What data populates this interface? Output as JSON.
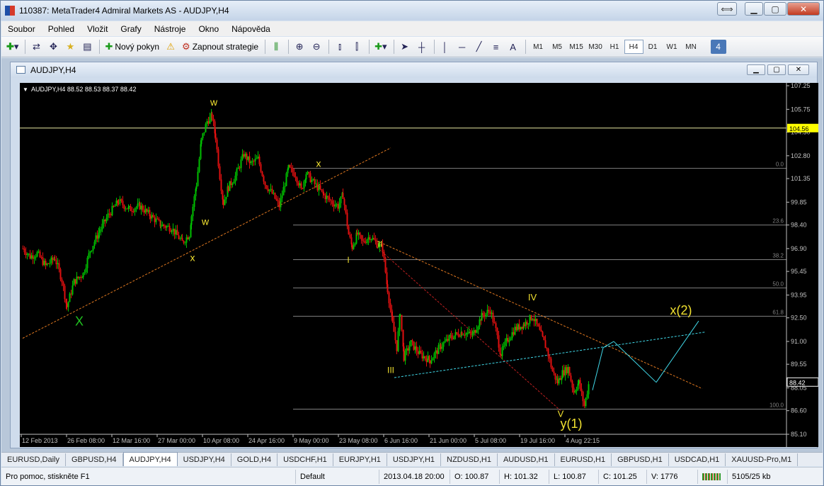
{
  "window": {
    "title": "110387: MetaTrader4 Admiral Markets AS - AUDJPY,H4"
  },
  "menu": [
    "Soubor",
    "Pohled",
    "Vložit",
    "Grafy",
    "Nástroje",
    "Okno",
    "Nápověda"
  ],
  "toolbar": {
    "new_order": "Nový pokyn",
    "autotrading": "Zapnout strategie",
    "text_tool": "A",
    "timeframes": [
      "M1",
      "M5",
      "M15",
      "M30",
      "H1",
      "H4",
      "D1",
      "W1",
      "MN"
    ],
    "selected_timeframe": "H4",
    "badge": "4"
  },
  "chart_window": {
    "title": "AUDJPY,H4"
  },
  "chart_data": {
    "type": "candlestick",
    "symbol_info": "AUDJPY,H4  88.52 88.53 88.37 88.42",
    "ylim": [
      85.1,
      107.25
    ],
    "y_ticks": [
      "107.25",
      "105.75",
      "104.30",
      "102.80",
      "101.35",
      "99.85",
      "98.40",
      "96.90",
      "95.45",
      "93.95",
      "92.50",
      "91.00",
      "89.55",
      "88.05",
      "86.60",
      "85.10"
    ],
    "x_ticks": [
      "12 Feb 2013",
      "26 Feb 08:00",
      "12 Mar 16:00",
      "27 Mar 00:00",
      "10 Apr 08:00",
      "24 Apr 16:00",
      "9 May 00:00",
      "23 May 08:00",
      "6 Jun 16:00",
      "21 Jun 00:00",
      "5 Jul 08:00",
      "19 Jul 16:00",
      "4 Aug 22:15"
    ],
    "price_path": [
      [
        0,
        96.9
      ],
      [
        10,
        96.4
      ],
      [
        20,
        96.6
      ],
      [
        32,
        95.8
      ],
      [
        45,
        96.3
      ],
      [
        55,
        94.9
      ],
      [
        62,
        93.2
      ],
      [
        72,
        94.8
      ],
      [
        85,
        95.3
      ],
      [
        95,
        96.8
      ],
      [
        108,
        98.0
      ],
      [
        120,
        99.0
      ],
      [
        135,
        99.9
      ],
      [
        150,
        99.4
      ],
      [
        165,
        99.6
      ],
      [
        180,
        99.0
      ],
      [
        195,
        98.4
      ],
      [
        210,
        98.2
      ],
      [
        225,
        97.3
      ],
      [
        235,
        97.8
      ],
      [
        238,
        99.0
      ],
      [
        245,
        101.0
      ],
      [
        252,
        103.8
      ],
      [
        260,
        105.0
      ],
      [
        267,
        105.3
      ],
      [
        272,
        104.0
      ],
      [
        278,
        101.5
      ],
      [
        283,
        99.8
      ],
      [
        290,
        100.8
      ],
      [
        300,
        101.5
      ],
      [
        312,
        102.9
      ],
      [
        322,
        102.3
      ],
      [
        332,
        102.6
      ],
      [
        342,
        101.0
      ],
      [
        352,
        100.4
      ],
      [
        362,
        99.6
      ],
      [
        375,
        102.0
      ],
      [
        385,
        101.6
      ],
      [
        393,
        100.6
      ],
      [
        400,
        101.7
      ],
      [
        410,
        101.1
      ],
      [
        418,
        100.7
      ],
      [
        425,
        100.3
      ],
      [
        435,
        99.9
      ],
      [
        445,
        99.6
      ],
      [
        452,
        100.3
      ],
      [
        460,
        97.8
      ],
      [
        465,
        97.0
      ],
      [
        472,
        97.8
      ],
      [
        480,
        97.3
      ],
      [
        490,
        97.7
      ],
      [
        500,
        97.2
      ],
      [
        508,
        96.9
      ],
      [
        515,
        94.3
      ],
      [
        522,
        92.1
      ],
      [
        528,
        90.6
      ],
      [
        533,
        92.9
      ],
      [
        538,
        90.0
      ],
      [
        548,
        90.9
      ],
      [
        560,
        90.2
      ],
      [
        575,
        89.8
      ],
      [
        590,
        90.7
      ],
      [
        605,
        91.3
      ],
      [
        620,
        91.6
      ],
      [
        635,
        91.4
      ],
      [
        648,
        92.6
      ],
      [
        660,
        93.0
      ],
      [
        668,
        91.7
      ],
      [
        675,
        90.2
      ],
      [
        683,
        91.0
      ],
      [
        695,
        91.8
      ],
      [
        708,
        92.1
      ],
      [
        720,
        92.6
      ],
      [
        730,
        91.6
      ],
      [
        740,
        90.5
      ],
      [
        748,
        89.1
      ],
      [
        755,
        88.4
      ],
      [
        762,
        89.0
      ],
      [
        770,
        89.3
      ],
      [
        778,
        87.8
      ],
      [
        785,
        88.4
      ],
      [
        793,
        86.9
      ],
      [
        800,
        88.5
      ]
    ],
    "last_price": "88.42",
    "horizontal_line": "104.56",
    "fibonacci_levels": [
      {
        "label": "0.0",
        "price": 102.0
      },
      {
        "label": "23.6",
        "price": 98.4
      },
      {
        "label": "38.2",
        "price": 96.2
      },
      {
        "label": "50.0",
        "price": 94.4
      },
      {
        "label": "61.8",
        "price": 92.6
      },
      {
        "label": "100.0",
        "price": 86.7
      }
    ],
    "wave_labels": [
      {
        "text": "X",
        "price": 92.0,
        "bar": 80,
        "color": "#20c020",
        "size": 18
      },
      {
        "text": "w",
        "price": 106.0,
        "bar": 270,
        "color": "#f0e030",
        "size": 14
      },
      {
        "text": "w",
        "price": 98.4,
        "bar": 258,
        "color": "#f0e030",
        "size": 14
      },
      {
        "text": "x",
        "price": 96.1,
        "bar": 240,
        "color": "#f0e030",
        "size": 14
      },
      {
        "text": "x",
        "price": 102.1,
        "bar": 418,
        "color": "#f0e030",
        "size": 14
      },
      {
        "text": "II",
        "price": 97.0,
        "bar": 505,
        "color": "#f0e030",
        "size": 12
      },
      {
        "text": "I",
        "price": 96.0,
        "bar": 460,
        "color": "#f0e030",
        "size": 12
      },
      {
        "text": "III",
        "price": 89.0,
        "bar": 520,
        "color": "#f0e030",
        "size": 12
      },
      {
        "text": "IV",
        "price": 93.6,
        "bar": 720,
        "color": "#f0e030",
        "size": 13
      },
      {
        "text": "V",
        "price": 86.2,
        "bar": 760,
        "color": "#f0e030",
        "size": 13
      },
      {
        "text": "y(1)",
        "price": 85.5,
        "bar": 775,
        "color": "#f0e030",
        "size": 18
      },
      {
        "text": "x(2)",
        "price": 92.7,
        "bar": 930,
        "color": "#f0e030",
        "size": 18
      }
    ]
  },
  "tabs": [
    "EURUSD,Daily",
    "GBPUSD,H4",
    "AUDJPY,H4",
    "USDJPY,H4",
    "GOLD,H4",
    "USDCHF,H1",
    "EURJPY,H1",
    "USDJPY,H1",
    "NZDUSD,H1",
    "AUDUSD,H1",
    "EURUSD,H1",
    "GBPUSD,H1",
    "USDCAD,H1",
    "XAUUSD-Pro,M1"
  ],
  "selected_tab": "AUDJPY,H4",
  "status": {
    "help": "Pro pomoc, stiskněte F1",
    "profile": "Default",
    "datetime": "2013.04.18 20:00",
    "open": "O: 100.87",
    "high": "H: 101.32",
    "low": "L: 100.87",
    "close": "C: 101.25",
    "volume": "V: 1776",
    "traffic": "5105/25 kb"
  },
  "colors": {
    "bull": "#00c000",
    "bear": "#e01010",
    "trend_orange": "#e07820",
    "trend_cyan": "#40d8e8",
    "wave_yellow": "#f0e030",
    "fib_gray": "#808080",
    "hline": "#e8e8a0"
  }
}
